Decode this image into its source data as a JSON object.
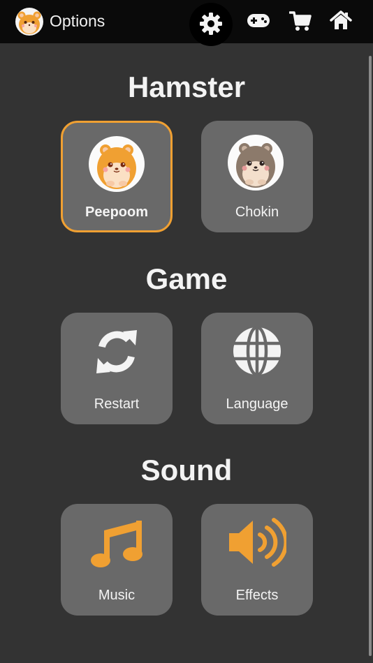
{
  "header": {
    "title": "Options",
    "brand_icon": "hamster-avatar-icon",
    "nav": [
      {
        "name": "settings",
        "icon": "gear-icon",
        "active": true
      },
      {
        "name": "games",
        "icon": "gamepad-icon",
        "active": false
      },
      {
        "name": "shop",
        "icon": "cart-icon",
        "active": false
      },
      {
        "name": "home",
        "icon": "home-icon",
        "active": false
      }
    ]
  },
  "sections": {
    "hamster": {
      "title": "Hamster",
      "options": [
        {
          "label": "Peepoom",
          "selected": true,
          "color": "#f0a032"
        },
        {
          "label": "Chokin",
          "selected": false,
          "color": "#8c7a6b"
        }
      ]
    },
    "game": {
      "title": "Game",
      "options": [
        {
          "label": "Restart",
          "icon": "restart-icon"
        },
        {
          "label": "Language",
          "icon": "globe-icon"
        }
      ]
    },
    "sound": {
      "title": "Sound",
      "options": [
        {
          "label": "Music",
          "icon": "music-note-icon"
        },
        {
          "label": "Effects",
          "icon": "speaker-icon"
        }
      ]
    }
  },
  "colors": {
    "background": "#333333",
    "header": "#0a0a0a",
    "tile": "#696969",
    "accent": "#f0a032",
    "text": "#f3f3f3"
  }
}
